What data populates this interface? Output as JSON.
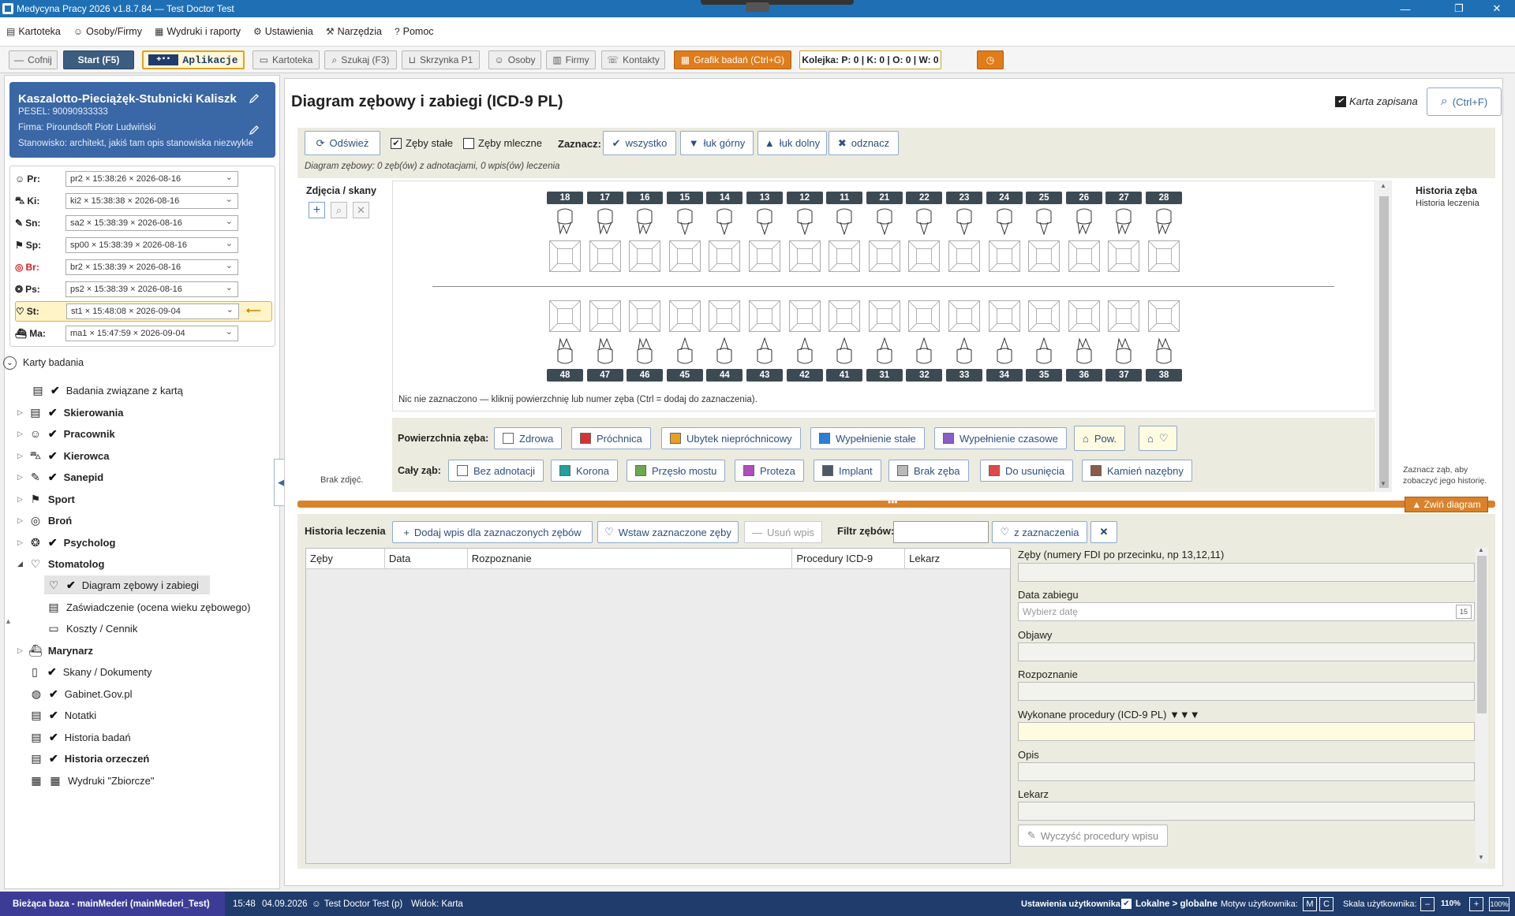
{
  "window": {
    "title": "Medycyna Pracy 2026 v1.8.7.84 — Test Doctor Test"
  },
  "menu": [
    {
      "label": "Kartoteka",
      "icon": "folder-icon"
    },
    {
      "label": "Osoby/Firmy",
      "icon": "people-icon"
    },
    {
      "label": "Wydruki i raporty",
      "icon": "print-icon"
    },
    {
      "label": "Ustawienia",
      "icon": "gear-icon"
    },
    {
      "label": "Narzędzia",
      "icon": "tools-icon"
    },
    {
      "label": "Pomoc",
      "icon": "help-icon"
    }
  ],
  "toolbar": {
    "back": "Cofnij",
    "start": "Start (F5)",
    "apps": "Aplikacje",
    "kartoteka": "Kartoteka",
    "search": "Szukaj (F3)",
    "inbox": "Skrzynka P1",
    "persons": "Osoby",
    "companies": "Firmy",
    "contacts": "Kontakty",
    "schedule": "Grafik badań (Ctrl+G)",
    "queue": "Kolejka: P: 0 | K: 0 | O: 0 | W: 0"
  },
  "patient": {
    "name": "Kaszalotto-Pieciążęk-Stubnicki  Kaliszk",
    "pesel": "PESEL: 90090933333",
    "company": "Firma: Piroundsoft  Piotr Ludwiński",
    "position": "Stanowisko: architekt, jakiś tam opis stanowiska niezwykle"
  },
  "visits": [
    {
      "label": "Pr:",
      "value": "pr2 × 15:38:26 × 2026-08-16",
      "color": "#333"
    },
    {
      "label": "Ki:",
      "value": "ki2 × 15:38:38 × 2026-08-16",
      "color": "#333"
    },
    {
      "label": "Sn:",
      "value": "sa2 × 15:38:39 × 2026-08-16",
      "color": "#333"
    },
    {
      "label": "Sp:",
      "value": "sp00 × 15:38:39 × 2026-08-16",
      "color": "#333"
    },
    {
      "label": "Br:",
      "value": "br2 × 15:38:39 × 2026-08-16",
      "color": "#d32020"
    },
    {
      "label": "Ps:",
      "value": "ps2 × 15:38:39 × 2026-08-16",
      "color": "#333"
    },
    {
      "label": "St:",
      "value": "st1 × 15:48:08 × 2026-09-04",
      "color": "#333"
    },
    {
      "label": "Ma:",
      "value": "ma1 × 15:47:59 × 2026-09-04",
      "color": "#333"
    }
  ],
  "tree": {
    "root": "Karty badania",
    "items": [
      {
        "label": "Badania związane z kartą",
        "checked": true,
        "bold": false
      },
      {
        "label": "Skierowania",
        "checked": true,
        "bold": true
      },
      {
        "label": "Pracownik",
        "checked": true,
        "bold": true
      },
      {
        "label": "Kierowca",
        "checked": true,
        "bold": true
      },
      {
        "label": "Sanepid",
        "checked": true,
        "bold": true
      },
      {
        "label": "Sport",
        "checked": false,
        "bold": true
      },
      {
        "label": "Broń",
        "checked": false,
        "bold": true
      },
      {
        "label": "Psycholog",
        "checked": true,
        "bold": true
      },
      {
        "label": "Stomatolog",
        "checked": false,
        "bold": true
      },
      {
        "label": "Diagram zębowy i zabiegi",
        "checked": true,
        "bold": false
      },
      {
        "label": "Zaświadczenie (ocena wieku zębowego)",
        "checked": false,
        "bold": false
      },
      {
        "label": "Koszty / Cennik",
        "checked": false,
        "bold": false
      },
      {
        "label": "Marynarz",
        "checked": false,
        "bold": true
      },
      {
        "label": "Skany / Dokumenty",
        "checked": true,
        "bold": false
      },
      {
        "label": "Gabinet.Gov.pl",
        "checked": true,
        "bold": false
      },
      {
        "label": "Notatki",
        "checked": true,
        "bold": false
      },
      {
        "label": "Historia badań",
        "checked": true,
        "bold": false
      },
      {
        "label": "Historia orzeczeń",
        "checked": true,
        "bold": true
      },
      {
        "label": "Wydruki \"Zbiorcze\"",
        "checked": false,
        "bold": false
      }
    ]
  },
  "main": {
    "title": "Diagram zębowy i zabiegi (ICD-9 PL)",
    "saved": "Karta zapisana",
    "search": "(Ctrl+F)"
  },
  "diagram_bar": {
    "refresh": "Odśwież",
    "permanent": "Zęby stałe",
    "permanent_checked": true,
    "milk": "Zęby mleczne",
    "milk_checked": false,
    "mark": "Zaznacz:",
    "all": "wszystko",
    "upper": "łuk górny",
    "lower": "łuk dolny",
    "unmark": "odznacz",
    "summary": "Diagram zębowy: 0 zęb(ów) z adnotacjami, 0 wpis(ów) leczenia"
  },
  "photos": {
    "title": "Zdjęcia / skany",
    "empty": "Brak zdjęć."
  },
  "teeth": {
    "upper": [
      "18",
      "17",
      "16",
      "15",
      "14",
      "13",
      "12",
      "11",
      "21",
      "22",
      "23",
      "24",
      "25",
      "26",
      "27",
      "28"
    ],
    "lower": [
      "48",
      "47",
      "46",
      "45",
      "44",
      "43",
      "42",
      "41",
      "31",
      "32",
      "33",
      "34",
      "35",
      "36",
      "37",
      "38"
    ],
    "hint": "Nic nie zaznaczono — kliknij powierzchnię lub numer zęba (Ctrl = dodaj do zaznaczenia)."
  },
  "surface": {
    "label": "Powierzchnia zęba:",
    "items": [
      {
        "label": "Zdrowa",
        "color": "#ffffff"
      },
      {
        "label": "Próchnica",
        "color": "#d93030"
      },
      {
        "label": "Ubytek niepróchnicowy",
        "color": "#e8a020"
      },
      {
        "label": "Wypełnienie stałe",
        "color": "#2b7fd6"
      },
      {
        "label": "Wypełnienie czasowe",
        "color": "#8a5cc8"
      }
    ],
    "pow": "Pow.",
    "whole_label": "Cały ząb:",
    "whole": [
      {
        "label": "Bez adnotacji",
        "color": "#ffffff"
      },
      {
        "label": "Korona",
        "color": "#20a0a0"
      },
      {
        "label": "Przęsło mostu",
        "color": "#6aa84f"
      },
      {
        "label": "Proteza",
        "color": "#b04cc0"
      },
      {
        "label": "Implant",
        "color": "#4a5a66"
      },
      {
        "label": "Brak zęba",
        "color": "#b8b8b8"
      },
      {
        "label": "Do usunięcia",
        "color": "#e04848"
      },
      {
        "label": "Kamień nazębny",
        "color": "#8a5a4a"
      }
    ]
  },
  "history_side": {
    "title": "Historia zęba",
    "subtitle": "Historia leczenia",
    "hint": "Zaznacz ząb, aby zobaczyć jego historię."
  },
  "collapse_diagram": "▲ Zwiń diagram",
  "history": {
    "title": "Historia leczenia",
    "add": "Dodaj wpis dla zaznaczonych zębów",
    "insert": "Wstaw zaznaczone zęby",
    "remove": "Usuń wpis",
    "filter_label": "Filtr zębów:",
    "filter_value": "",
    "from_selection": "z zaznaczenia",
    "columns": [
      "Zęby",
      "Data",
      "Rozpoznanie",
      "Procedury ICD-9",
      "Lekarz"
    ]
  },
  "form": {
    "teeth_label": "Zęby (numery FDI po przecinku, np 13,12,11)",
    "date_label": "Data zabiegu",
    "date_placeholder": "Wybierz datę",
    "date_icon": "15",
    "symptoms_label": "Objawy",
    "diagnosis_label": "Rozpoznanie",
    "procedures_label": "Wykonane procedury (ICD-9 PL) ▼▼▼",
    "description_label": "Opis",
    "doctor_label": "Lekarz",
    "clear": "Wyczyść procedury wpisu"
  },
  "status": {
    "db": "Bieżąca baza - mainMederi (mainMederi_Test)",
    "time": "15:48",
    "date": "04.09.2026",
    "user": "Test Doctor Test (p)",
    "view": "Widok: Karta",
    "user_settings": "Ustawienia użytkownika",
    "local_global": "Lokalne > globalne",
    "theme_label": "Motyw użytkownika:",
    "theme_m": "M",
    "theme_c": "C",
    "scale_label": "Skala użytkownika:",
    "scale_minus": "–",
    "scale_value": "110%",
    "scale_plus": "+",
    "scale_reset": "100%"
  }
}
